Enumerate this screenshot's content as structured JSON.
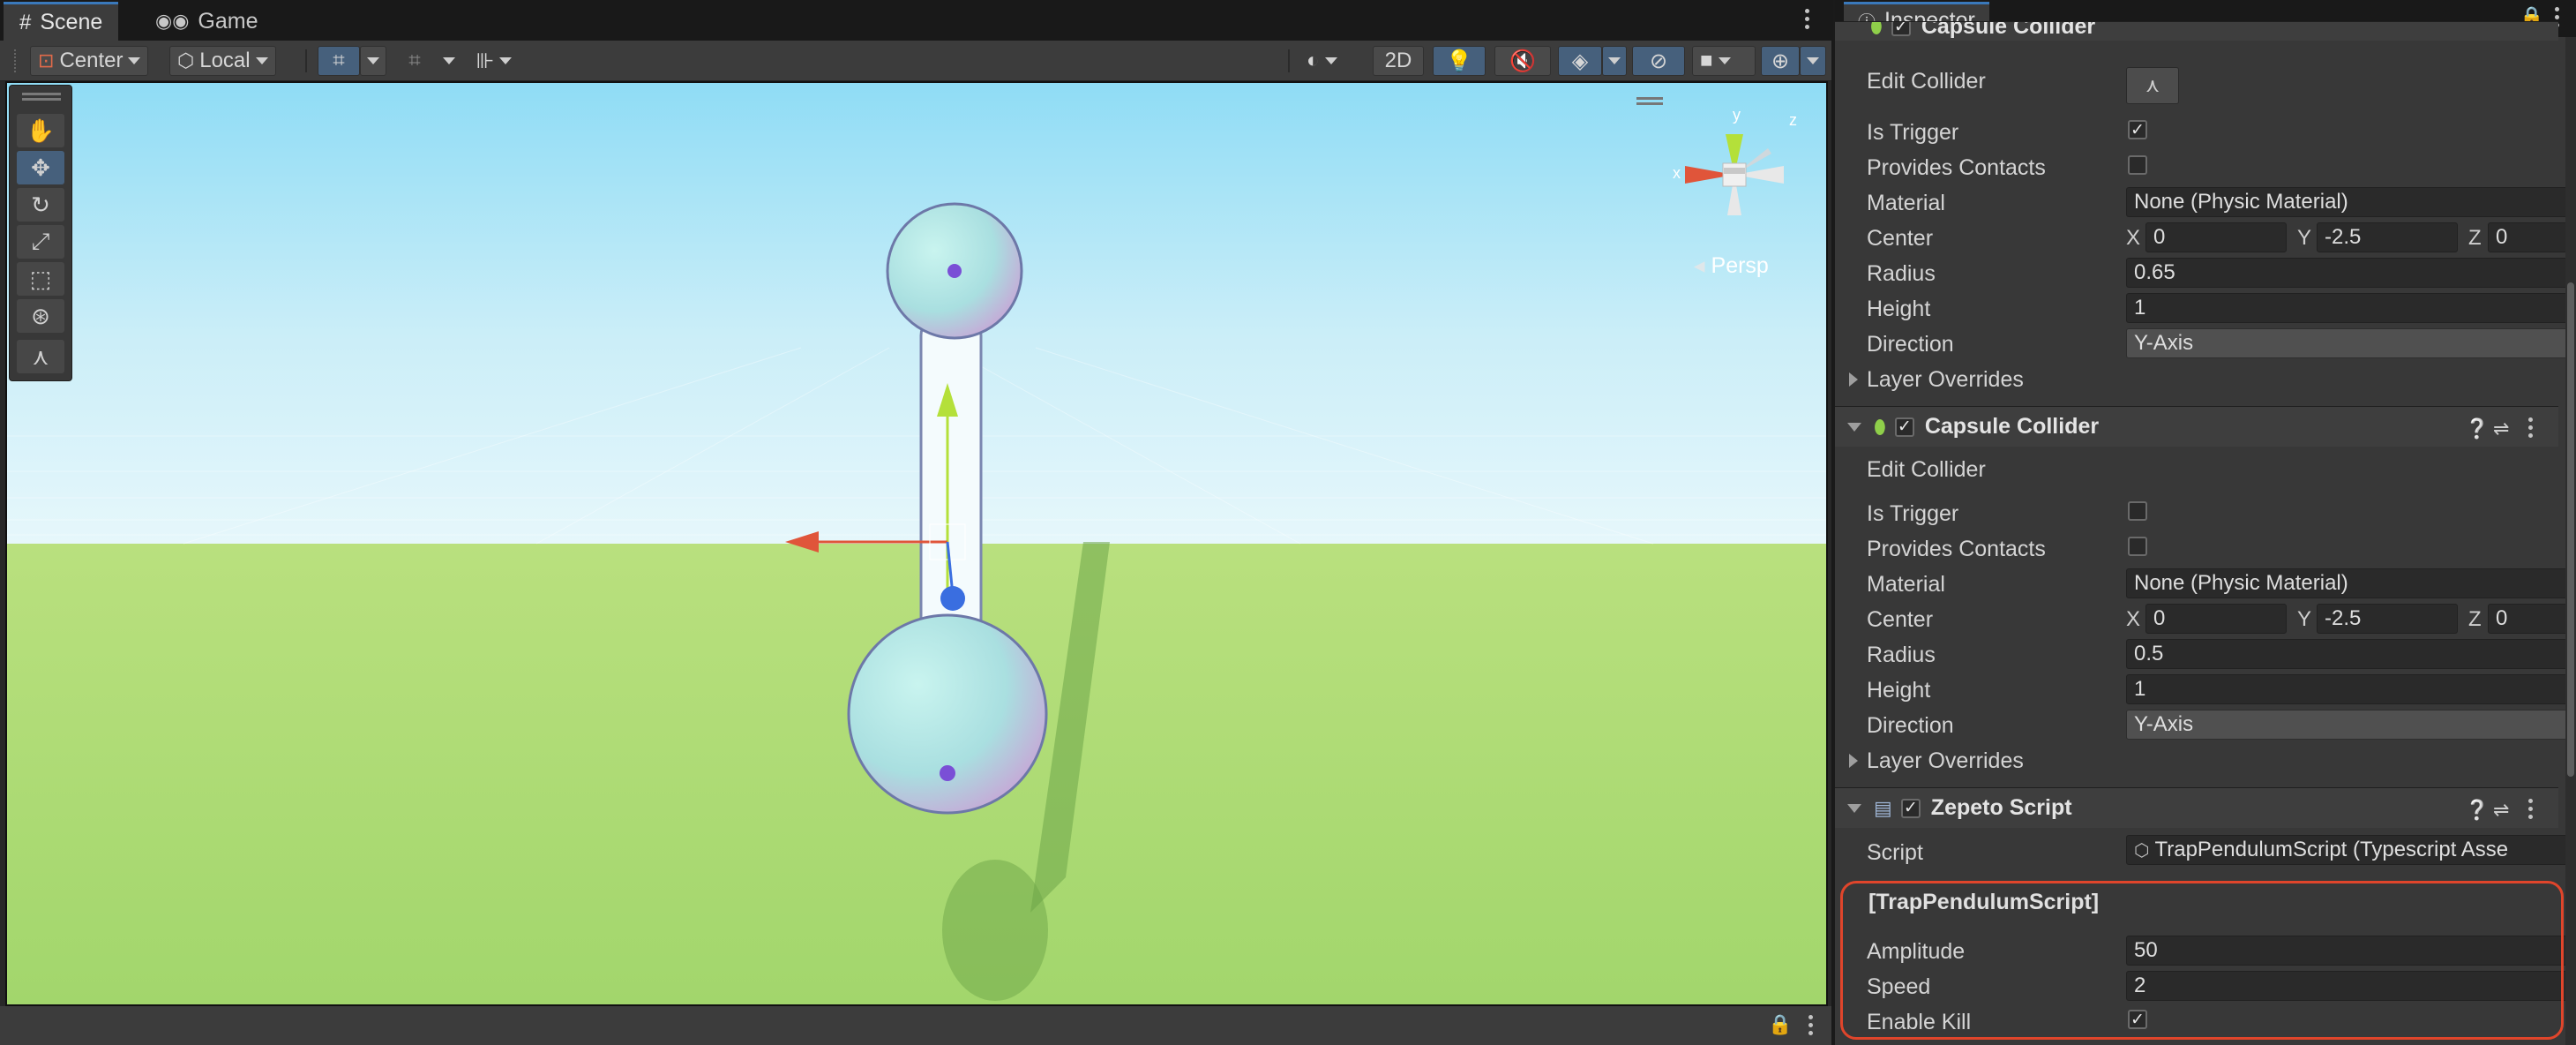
{
  "scene_panel": {
    "tabs": [
      {
        "label": "Scene",
        "icon": "grid-icon",
        "active": true
      },
      {
        "label": "Game",
        "icon": "gamepad-icon",
        "active": false
      }
    ],
    "toolbar": {
      "pivot_label": "Center",
      "space_label": "Local",
      "mode_2d_label": "2D"
    },
    "view_label": "Persp",
    "gizmo_axes": {
      "x": "x",
      "y": "y",
      "z": "z"
    }
  },
  "inspector": {
    "tab_label": "Inspector",
    "components": [
      {
        "title": "Capsule Collider",
        "enabled": true,
        "edit_collider_label": "Edit Collider",
        "is_trigger": {
          "label": "Is Trigger",
          "checked": true
        },
        "provides_contacts": {
          "label": "Provides Contacts",
          "checked": false
        },
        "material": {
          "label": "Material",
          "value": "None (Physic Material)"
        },
        "center": {
          "label": "Center",
          "x": "0",
          "y": "-2.5",
          "z": "0"
        },
        "radius": {
          "label": "Radius",
          "value": "0.65"
        },
        "height": {
          "label": "Height",
          "value": "1"
        },
        "direction": {
          "label": "Direction",
          "value": "Y-Axis"
        },
        "layer_overrides_label": "Layer Overrides"
      },
      {
        "title": "Capsule Collider",
        "enabled": true,
        "edit_collider_label": "Edit Collider",
        "is_trigger": {
          "label": "Is Trigger",
          "checked": false
        },
        "provides_contacts": {
          "label": "Provides Contacts",
          "checked": false
        },
        "material": {
          "label": "Material",
          "value": "None (Physic Material)"
        },
        "center": {
          "label": "Center",
          "x": "0",
          "y": "-2.5",
          "z": "0"
        },
        "radius": {
          "label": "Radius",
          "value": "0.5"
        },
        "height": {
          "label": "Height",
          "value": "1"
        },
        "direction": {
          "label": "Direction",
          "value": "Y-Axis"
        },
        "layer_overrides_label": "Layer Overrides"
      }
    ],
    "zepeto_script": {
      "title": "Zepeto Script",
      "enabled": true,
      "script": {
        "label": "Script",
        "value": "TrapPendulumScript (Typescript Asse"
      },
      "section_header": "[TrapPendulumScript]",
      "amplitude": {
        "label": "Amplitude",
        "value": "50"
      },
      "speed": {
        "label": "Speed",
        "value": "2"
      },
      "enable_kill": {
        "label": "Enable Kill",
        "checked": true
      }
    },
    "axis_labels": {
      "x": "X",
      "y": "Y",
      "z": "Z"
    }
  },
  "colors": {
    "highlight": "#e0452b",
    "selected_blue": "#46607c",
    "sky": "#cbeef8",
    "ground": "#a9d873"
  }
}
